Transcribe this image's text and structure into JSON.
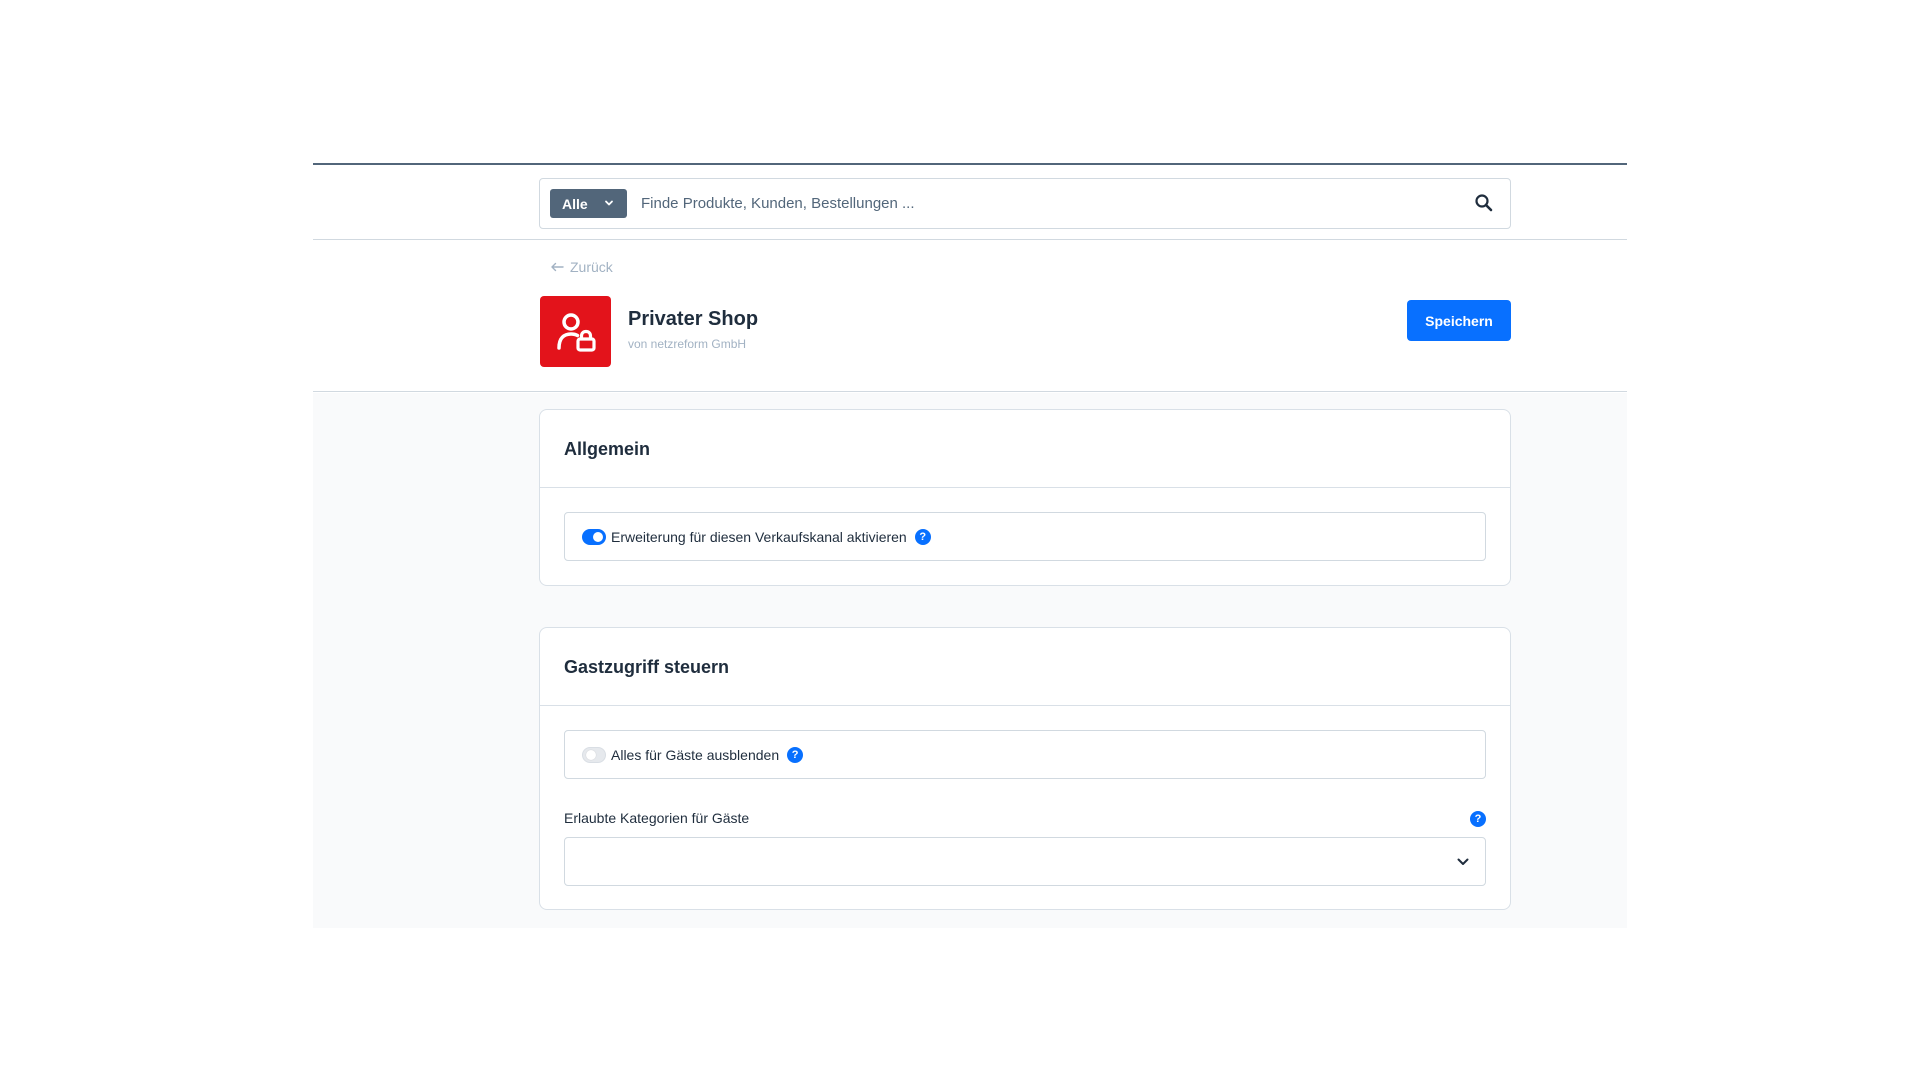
{
  "search": {
    "type_label": "Alle",
    "placeholder": "Finde Produkte, Kunden, Bestellungen ..."
  },
  "header": {
    "back_label": "Zurück",
    "app_title": "Privater Shop",
    "app_subtitle": "von netzreform GmbH",
    "save_label": "Speichern",
    "logo_icon": "user-lock-icon",
    "logo_color": "#e3131b"
  },
  "sections": {
    "general": {
      "title": "Allgemein",
      "activate_label": "Erweiterung für diesen Verkaufskanal aktivieren",
      "activate_on": true
    },
    "guest": {
      "title": "Gastzugriff steuern",
      "hide_all_label": "Alles für Gäste ausblenden",
      "hide_all_on": false,
      "categories_label": "Erlaubte Kategorien für Gäste",
      "categories_value": ""
    }
  },
  "help_glyph": "?",
  "colors": {
    "primary": "#0870ff",
    "dark_gray": "#52667a",
    "muted_text": "#a2b2c3"
  }
}
